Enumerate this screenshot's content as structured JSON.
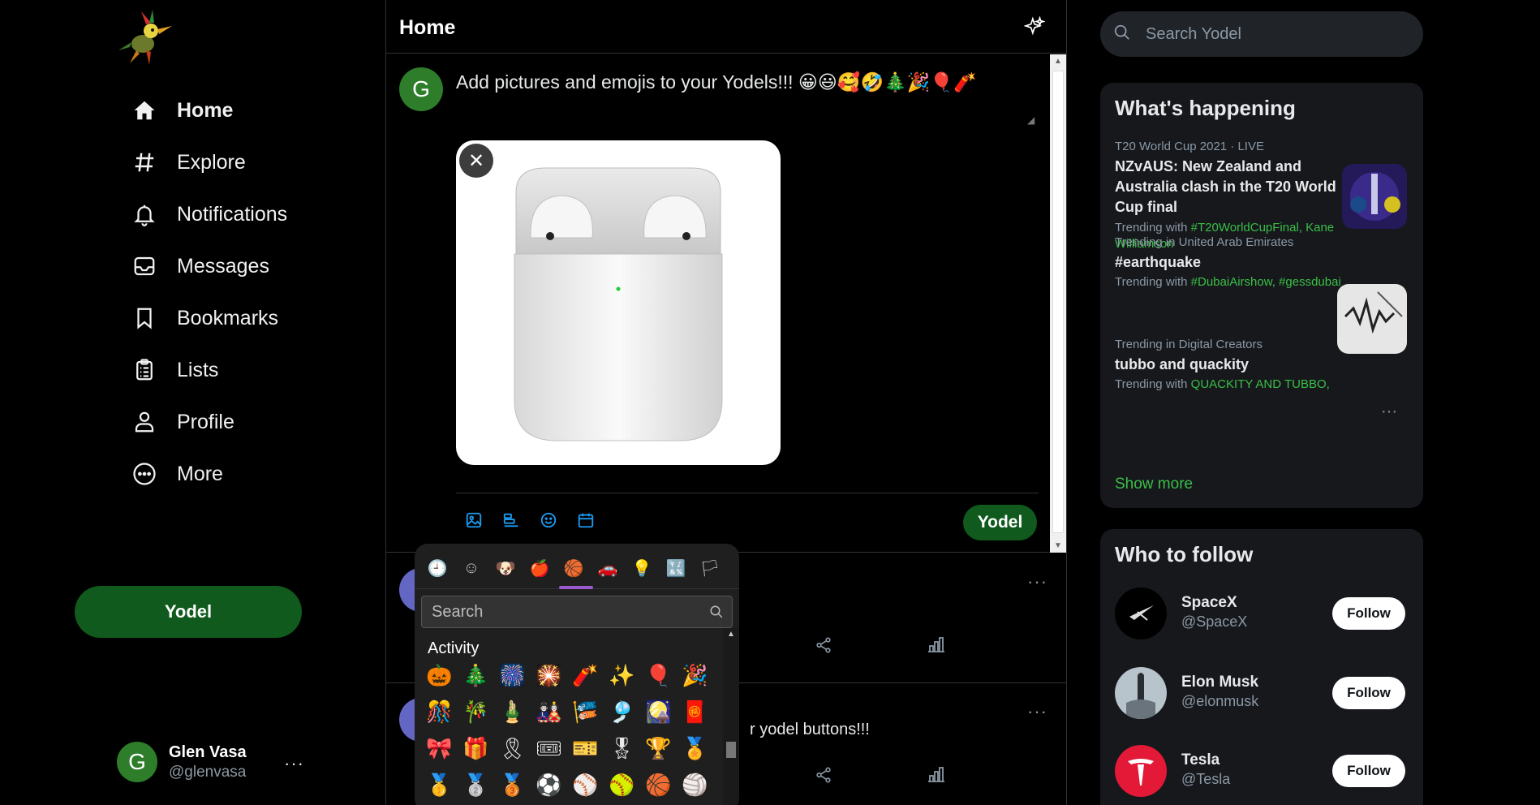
{
  "sidebar": {
    "nav": [
      {
        "label": "Home",
        "icon": "home-icon"
      },
      {
        "label": "Explore",
        "icon": "hashtag-icon"
      },
      {
        "label": "Notifications",
        "icon": "bell-icon"
      },
      {
        "label": "Messages",
        "icon": "envelope-icon"
      },
      {
        "label": "Bookmarks",
        "icon": "bookmark-icon"
      },
      {
        "label": "Lists",
        "icon": "list-icon"
      },
      {
        "label": "Profile",
        "icon": "person-icon"
      },
      {
        "label": "More",
        "icon": "more-circle-icon"
      }
    ],
    "yodel_button": "Yodel",
    "user": {
      "initial": "G",
      "name": "Glen Vasa",
      "handle": "@glenvasa",
      "more": "···"
    }
  },
  "center": {
    "title": "Home",
    "composer": {
      "avatar_initial": "G",
      "text": "Add pictures and emojis to your Yodels!!! 😀😃🥰🤣🎄🎉🎈🧨",
      "remove_media": "✕",
      "submit": "Yodel"
    },
    "posts": [
      {
        "text": "",
        "more": "···"
      },
      {
        "text": "r yodel buttons!!!",
        "more": "···"
      }
    ],
    "emoji_picker": {
      "categories": [
        "🕘",
        "☺",
        "🐶",
        "🍎",
        "🏀",
        "🚗",
        "💡",
        "🔣",
        "🏳"
      ],
      "search_placeholder": "Search",
      "section_title": "Activity",
      "emojis": [
        "🎃",
        "🎄",
        "🎆",
        "🎇",
        "🧨",
        "✨",
        "🎈",
        "🎉",
        "🎊",
        "🎋",
        "🎍",
        "🎎",
        "🎏",
        "🎐",
        "🎑",
        "🧧",
        "🎀",
        "🎁",
        "🎗",
        "🎟",
        "🎫",
        "🎖",
        "🏆",
        "🏅",
        "🥇",
        "🥈",
        "🥉",
        "⚽",
        "⚾",
        "🥎",
        "🏀",
        "🏐"
      ]
    }
  },
  "right": {
    "search_placeholder": "Search Yodel",
    "whats_happening": {
      "title": "What's happening",
      "trends": [
        {
          "meta": "T20 World Cup 2021 · LIVE",
          "headline": "NZvAUS: New Zealand and Australia clash in the T20 World Cup final",
          "with_prefix": "Trending with ",
          "tags": "#T20WorldCupFinal, Kane Williamson"
        },
        {
          "meta": "Trending in United Arab Emirates",
          "headline": "#earthquake",
          "with_prefix": "Trending with ",
          "tags": "#DubaiAirshow, #gessdubai"
        },
        {
          "meta": "Trending in Digital Creators",
          "headline": "tubbo and quackity",
          "with_prefix": "Trending with ",
          "tags": "QUACKITY AND TUBBO,",
          "more": "···"
        }
      ],
      "show_more": "Show more"
    },
    "who_to_follow": {
      "title": "Who to follow",
      "accounts": [
        {
          "name": "SpaceX",
          "handle": "@SpaceX",
          "button": "Follow"
        },
        {
          "name": "Elon Musk",
          "handle": "@elonmusk",
          "button": "Follow"
        },
        {
          "name": "Tesla",
          "handle": "@Tesla",
          "button": "Follow"
        }
      ]
    }
  },
  "colors": {
    "accent_green": "#0f5a1c",
    "link_green": "#3bbf46",
    "tool_blue": "#1d9bf0",
    "picker_purple": "#9b59d0"
  }
}
